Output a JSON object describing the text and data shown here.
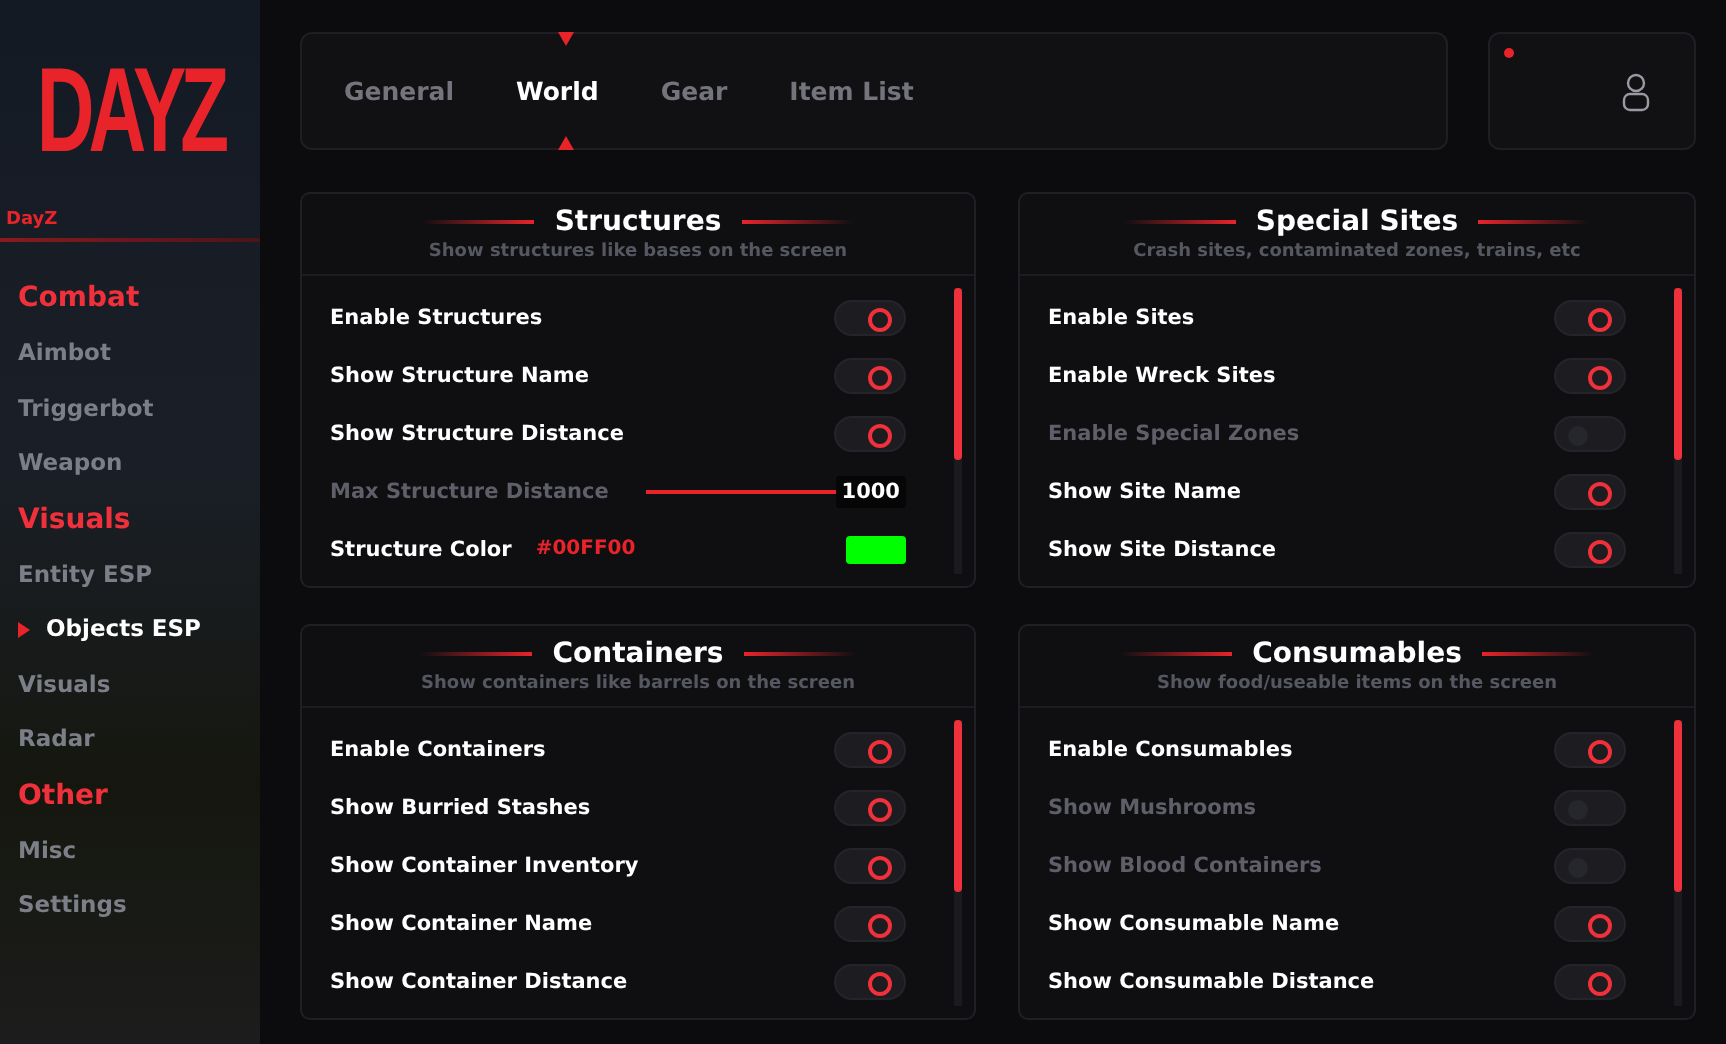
{
  "sidebar": {
    "logo": "DAYZ",
    "game": "DayZ",
    "sections": [
      {
        "title": "Combat",
        "items": [
          {
            "label": "Aimbot",
            "selected": false
          },
          {
            "label": "Triggerbot",
            "selected": false
          },
          {
            "label": "Weapon",
            "selected": false
          }
        ]
      },
      {
        "title": "Visuals",
        "items": [
          {
            "label": "Entity ESP",
            "selected": false
          },
          {
            "label": "Objects ESP",
            "selected": true
          },
          {
            "label": "Visuals",
            "selected": false
          },
          {
            "label": "Radar",
            "selected": false
          }
        ]
      },
      {
        "title": "Other",
        "items": [
          {
            "label": "Misc",
            "selected": false
          },
          {
            "label": "Settings",
            "selected": false
          }
        ]
      }
    ]
  },
  "tabs": [
    {
      "label": "General",
      "selected": false
    },
    {
      "label": "World",
      "selected": true
    },
    {
      "label": "Gear",
      "selected": false
    },
    {
      "label": "Item List",
      "selected": false
    }
  ],
  "profile": {
    "notification": true
  },
  "panels": [
    {
      "title": "Structures",
      "subtitle": "Show structures like bases on the screen",
      "rows": [
        {
          "kind": "toggle",
          "label": "Enable Structures",
          "on": true
        },
        {
          "kind": "toggle",
          "label": "Show Structure Name",
          "on": true
        },
        {
          "kind": "toggle",
          "label": "Show Structure Distance",
          "on": true
        },
        {
          "kind": "slider",
          "label": "Max Structure Distance",
          "value": "1000",
          "level": 1
        },
        {
          "kind": "color",
          "label": "Structure Color",
          "value": "#00FF00",
          "color": "#00ff00"
        }
      ]
    },
    {
      "title": "Special Sites",
      "subtitle": "Crash sites, contaminated zones, trains, etc",
      "rows": [
        {
          "kind": "toggle",
          "label": "Enable Sites",
          "on": true
        },
        {
          "kind": "toggle",
          "label": "Enable Wreck Sites",
          "on": true
        },
        {
          "kind": "toggle",
          "label": "Enable Special Zones",
          "on": false
        },
        {
          "kind": "toggle",
          "label": "Show Site Name",
          "on": true
        },
        {
          "kind": "toggle",
          "label": "Show Site Distance",
          "on": true
        }
      ]
    },
    {
      "title": "Containers",
      "subtitle": "Show containers like barrels on the screen",
      "rows": [
        {
          "kind": "toggle",
          "label": "Enable Containers",
          "on": true
        },
        {
          "kind": "toggle",
          "label": "Show Burried Stashes",
          "on": true
        },
        {
          "kind": "toggle",
          "label": "Show Container Inventory",
          "on": true
        },
        {
          "kind": "toggle",
          "label": "Show Container Name",
          "on": true
        },
        {
          "kind": "toggle",
          "label": "Show Container Distance",
          "on": true
        }
      ]
    },
    {
      "title": "Consumables",
      "subtitle": "Show food/useable items on the screen",
      "rows": [
        {
          "kind": "toggle",
          "label": "Enable Consumables",
          "on": true
        },
        {
          "kind": "toggle",
          "label": "Show Mushrooms",
          "on": false
        },
        {
          "kind": "toggle",
          "label": "Show Blood Containers",
          "on": false
        },
        {
          "kind": "toggle",
          "label": "Show Consumable Name",
          "on": true
        },
        {
          "kind": "toggle",
          "label": "Show Consumable Distance",
          "on": true
        }
      ]
    }
  ]
}
